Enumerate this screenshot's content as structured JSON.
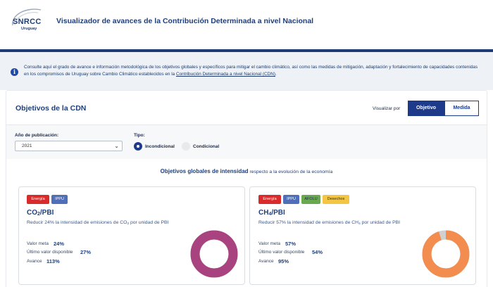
{
  "header": {
    "logo_text": "SNRCC",
    "logo_sub": "Uruguay",
    "title": "Visualizador de avances de la Contribución Determinada a nivel Nacional"
  },
  "info": {
    "text": "Consulte aquí el grado de avance e información metodológica de los objetivos globales y específicos para mitigar el cambio climático, así como las medidas de mitigación, adaptación y fortalecimiento de capacidades contenidas en los compromisos de Uruguay sobre Cambio Climático establecidos en la ",
    "link": "Contribución Determinada a nivel Nacional (CDN)",
    "tail": "."
  },
  "panel": {
    "title": "Objetivos de la CDN",
    "visualizar_label": "Visualizar por",
    "toggle": [
      "Objetivo",
      "Medida"
    ],
    "active_toggle": "Objetivo"
  },
  "filters": {
    "year_label": "Año de publicación:",
    "year_value": "2021",
    "tipo_label": "Tipo:",
    "radio_options": [
      "Incondicional",
      "Condicional"
    ],
    "selected_radio": "Incondicional"
  },
  "section": {
    "bold": "Objetivos globales de intensidad",
    "rest": " respecto a la evolución de la economía"
  },
  "cards": [
    {
      "tags": [
        {
          "label": "Energía",
          "bg": "#d92b2b",
          "fg": "#ffffff"
        },
        {
          "label": "IPPU",
          "bg": "#4f6fb8",
          "fg": "#ffffff"
        }
      ],
      "gas": "CO",
      "gas_sub": "2",
      "title_suffix": "/PBI",
      "desc_pre": "Reducir 24% la intensidad de emisiones de CO",
      "desc_sub": "2",
      "desc_post": " por unidad de PBI",
      "metrics": [
        {
          "label": "Valor meta",
          "value": "24%"
        },
        {
          "label": "Último valor disponible",
          "value": "27%"
        },
        {
          "label": "Avance",
          "value": "113%"
        }
      ],
      "progress": 1.0,
      "donut_color": "#a8437f",
      "donut_rest": "#d9d9d9"
    },
    {
      "tags": [
        {
          "label": "Energía",
          "bg": "#d92b2b",
          "fg": "#ffffff"
        },
        {
          "label": "IPPU",
          "bg": "#4f6fb8",
          "fg": "#ffffff"
        },
        {
          "label": "AFOLU",
          "bg": "#6aa84f",
          "fg": "#1c2b4a"
        },
        {
          "label": "Desechos",
          "bg": "#f4c542",
          "fg": "#1c2b4a"
        }
      ],
      "gas": "CH",
      "gas_sub": "4",
      "title_suffix": "/PBI",
      "desc_pre": "Reducir 57% la intensidad de emisiones de CH",
      "desc_sub": "4",
      "desc_post": " por unidad de PBI",
      "metrics": [
        {
          "label": "Valor meta",
          "value": "57%"
        },
        {
          "label": "Último valor disponible",
          "value": "54%"
        },
        {
          "label": "Avance",
          "value": "95%"
        }
      ],
      "progress": 0.95,
      "donut_color": "#f28c4f",
      "donut_rest": "#d0d0d0"
    }
  ]
}
